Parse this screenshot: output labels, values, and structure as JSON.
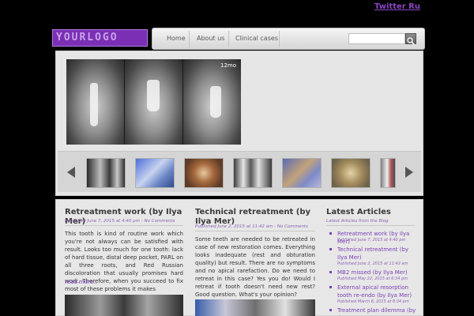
{
  "header": {
    "top_link": "Twitter Ru",
    "logo_text": "YOURLOGO"
  },
  "nav": {
    "items": [
      "Home",
      "About us",
      "Clinical cases"
    ],
    "search_placeholder": ""
  },
  "slider": {
    "image_tag": "12mo",
    "thumbnails": 8
  },
  "posts": [
    {
      "title": "Retreatment work (by Ilya Mer)",
      "meta": "Published June 7, 2015 at 4:40 pm - No Comments",
      "text": "This tooth is kind of routine work which you're not always can be satisfied with result. Looks too much for one tooth: lack of hard tissue, distal deep pocket, PARL on all three roots, and Red Russian discoloration that usually promises hard work. Therefore, when you succeed to fix most of these problems it makes",
      "read_more": "read more.."
    },
    {
      "title": "Technical retreatment (by Ilya Mer)",
      "meta": "Published June 2, 2015 at 11:42 am - No Comments",
      "text": "Some teeth are needed to be retreated in case of new restoration comes. Everything looks inadequate (rest and obturation quality) but result. There are no symptoms and no apical rarefaction. Do we need to retreat in this case? Yes you do! Would I retreat if tooth doesn't need new rest? Good question. What's your opinion?"
    }
  ],
  "sidebar": {
    "title": "Latest Articles",
    "subtitle": "Latest Articles from the Blog",
    "articles": [
      {
        "label": "Retreatment work (by Ilya Mer)",
        "date": "Published June 7, 2015 at 4:40 pm"
      },
      {
        "label": "Technical retreatment (by Ilya Mer)",
        "date": "Published June 2, 2015 at 11:42 am"
      },
      {
        "label": "MB2 missed (by Ilya Mer)",
        "date": "Published May 22, 2015 at 6:34 pm"
      },
      {
        "label": "External apical resorption tooth re-endo (by Ilya Mer)",
        "date": "Published March 6, 2015 at 8:34 pm"
      },
      {
        "label": "Treatment plan dilemma (by Ilya",
        "date": ""
      }
    ]
  },
  "colors": {
    "accent": "#7a3fb6",
    "background": "#000000",
    "panel": "#e6e6e6"
  }
}
